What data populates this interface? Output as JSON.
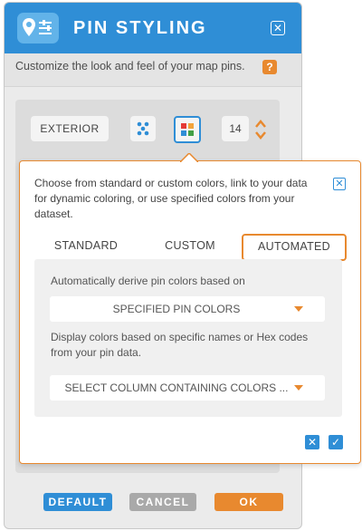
{
  "header": {
    "title": "PIN STYLING",
    "close_icon": "close-icon"
  },
  "description": "Customize the look and feel of your map pins.",
  "help_icon_text": "?",
  "toolbar": {
    "exterior_label": "EXTERIOR",
    "size_value": "14"
  },
  "popup": {
    "description": "Choose from standard or custom colors, link to your data for dynamic coloring, or use specified colors from your dataset.",
    "tabs": [
      {
        "label": "STANDARD",
        "active": false
      },
      {
        "label": "CUSTOM",
        "active": false
      },
      {
        "label": "AUTOMATED",
        "active": true
      }
    ],
    "derive_label": "Automatically derive pin colors based on",
    "derive_selected": "SPECIFIED PIN COLORS",
    "display_label": "Display colors based on specific names or Hex codes from your pin data.",
    "column_placeholder": "SELECT COLUMN CONTAINING COLORS ..."
  },
  "footer": {
    "default_label": "DEFAULT",
    "cancel_label": "CANCEL",
    "ok_label": "OK"
  },
  "colors": {
    "header_blue": "#2f8ed6",
    "accent_orange": "#e8892f",
    "cancel_gray": "#a9a9a9"
  }
}
